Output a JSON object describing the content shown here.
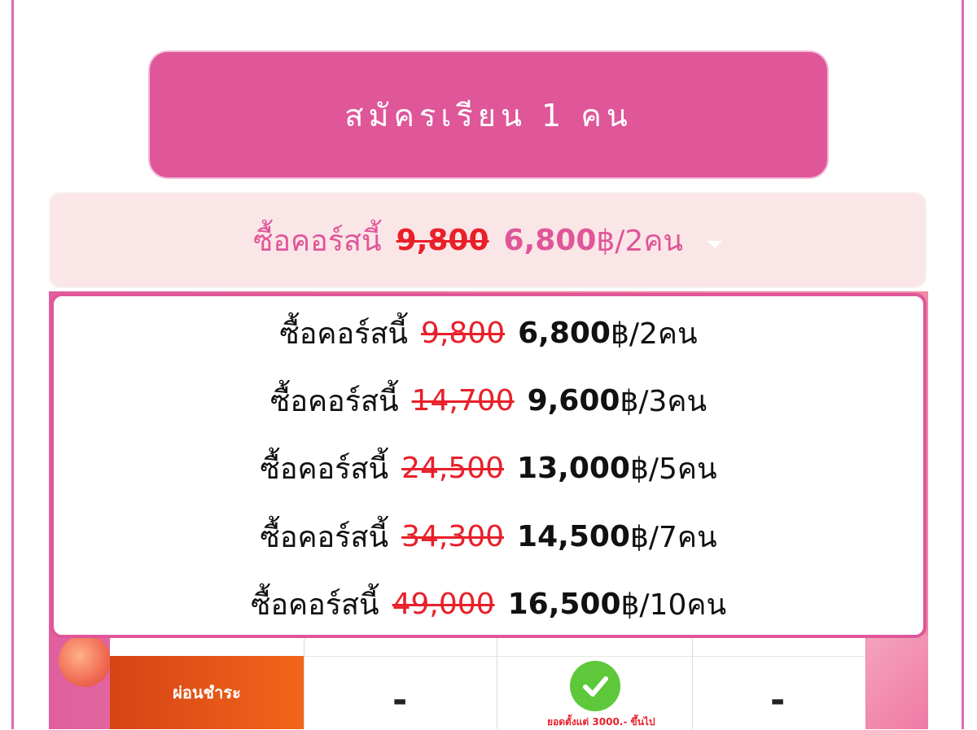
{
  "signup_button": {
    "label": "สมัครเรียน 1 คน"
  },
  "select": {
    "prefix": "ซื้อคอร์สนี้",
    "old_price": "9,800",
    "new_price": "6,800",
    "suffix": "฿/2คน"
  },
  "options": [
    {
      "prefix": "ซื้อคอร์สนี้",
      "old_price": "9,800",
      "new_price": "6,800",
      "suffix": "฿/2คน"
    },
    {
      "prefix": "ซื้อคอร์สนี้",
      "old_price": "14,700",
      "new_price": "9,600",
      "suffix": "฿/3คน"
    },
    {
      "prefix": "ซื้อคอร์สนี้",
      "old_price": "24,500",
      "new_price": "13,000",
      "suffix": "฿/5คน"
    },
    {
      "prefix": "ซื้อคอร์สนี้",
      "old_price": "34,300",
      "new_price": "14,500",
      "suffix": "฿/7คน"
    },
    {
      "prefix": "ซื้อคอร์สนี้",
      "old_price": "49,000",
      "new_price": "16,500",
      "suffix": "฿/10คน"
    }
  ],
  "table": {
    "row_label": "ผ่อนชำระ",
    "col1": "-",
    "col2_note": "ยอดตั้งแต่ 3000.- ขึ้นไป",
    "col3": "-"
  },
  "colors": {
    "brand_pink": "#df5699",
    "strike_red": "#e8202a",
    "check_green": "#5cc83a",
    "orange": "#f2651b"
  }
}
